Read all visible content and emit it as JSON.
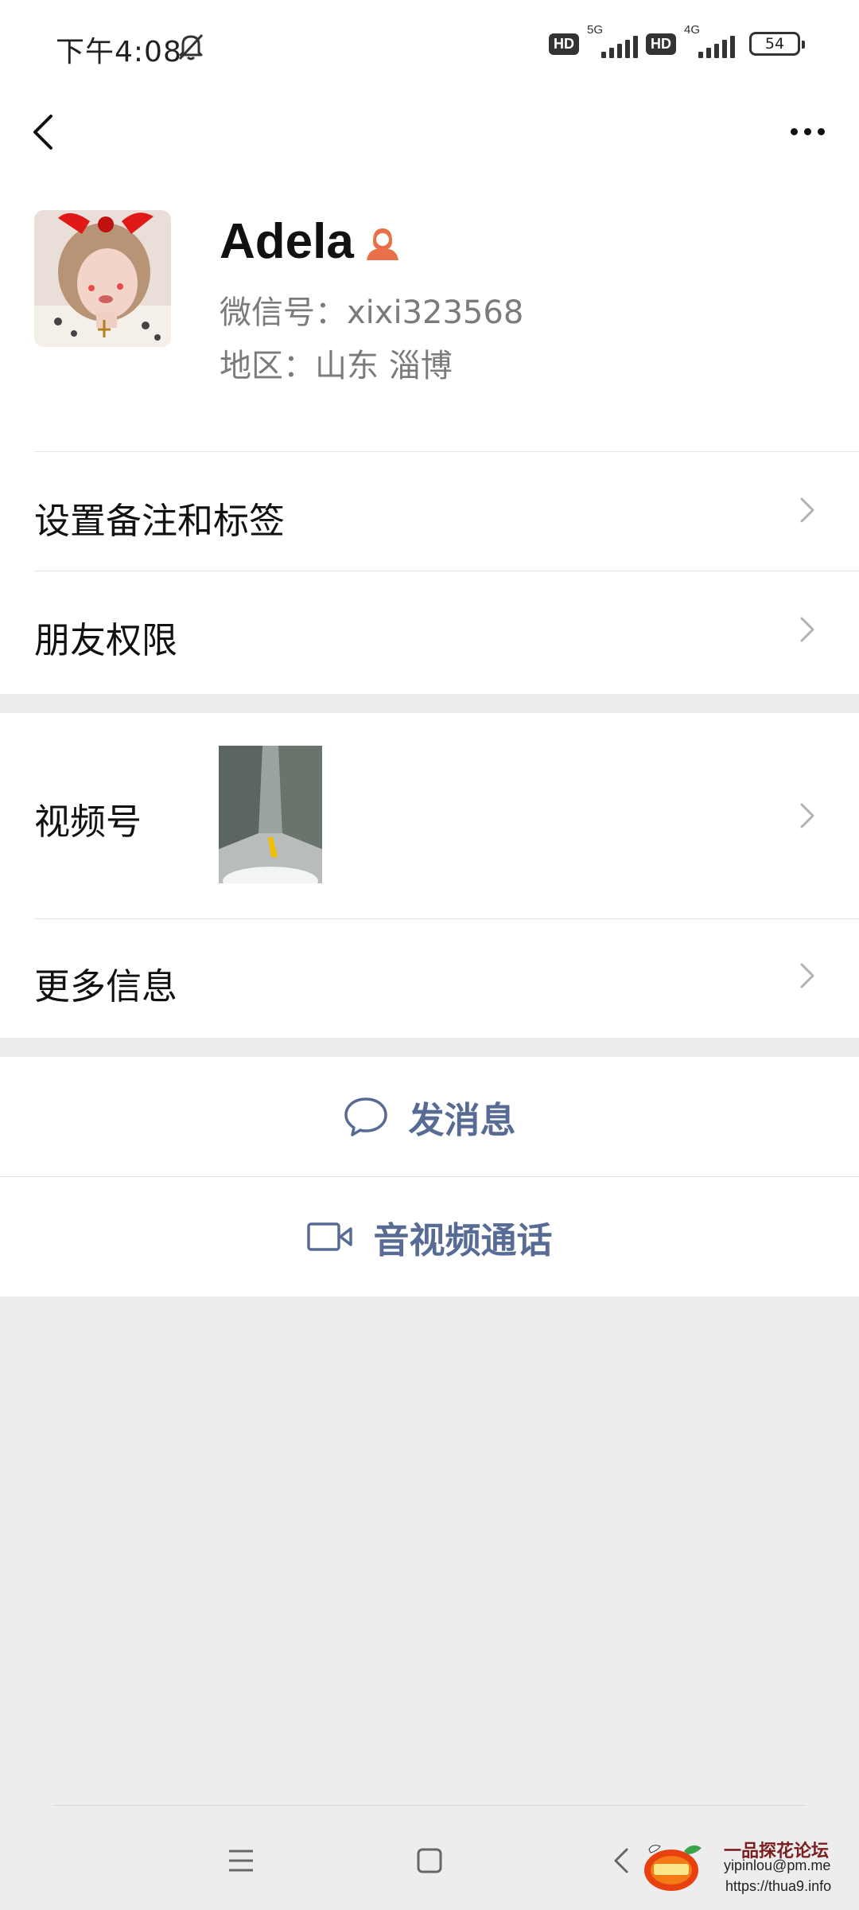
{
  "status_bar": {
    "time": "下午4:08",
    "sim1": {
      "badge": "HD",
      "network": "5G"
    },
    "sim2": {
      "badge": "HD",
      "network": "4G"
    },
    "battery": "54",
    "icons": [
      "bell-muted-icon",
      "signal-icon",
      "battery-icon"
    ]
  },
  "nav": {
    "back_icon": "chevron-left-icon",
    "more_icon": "more-dots-icon"
  },
  "profile": {
    "name": "Adela",
    "gender_icon": "female-user-icon",
    "wechat_id": "微信号：xixi323568",
    "region": "地区：山东  淄博"
  },
  "rows": {
    "remark_tags": "设置备注和标签",
    "friend_permissions": "朋友权限",
    "channels": "视频号",
    "more_info": "更多信息"
  },
  "actions": {
    "send_message": "发消息",
    "video_call": "音视频通话"
  },
  "watermark": {
    "title": "一品探花论坛",
    "email": "yipinlou@pm.me",
    "url": "https://thua9.info"
  },
  "colors": {
    "link_blue": "#576b95",
    "gender_orange": "#e8704a",
    "background_gray": "#ededed"
  }
}
